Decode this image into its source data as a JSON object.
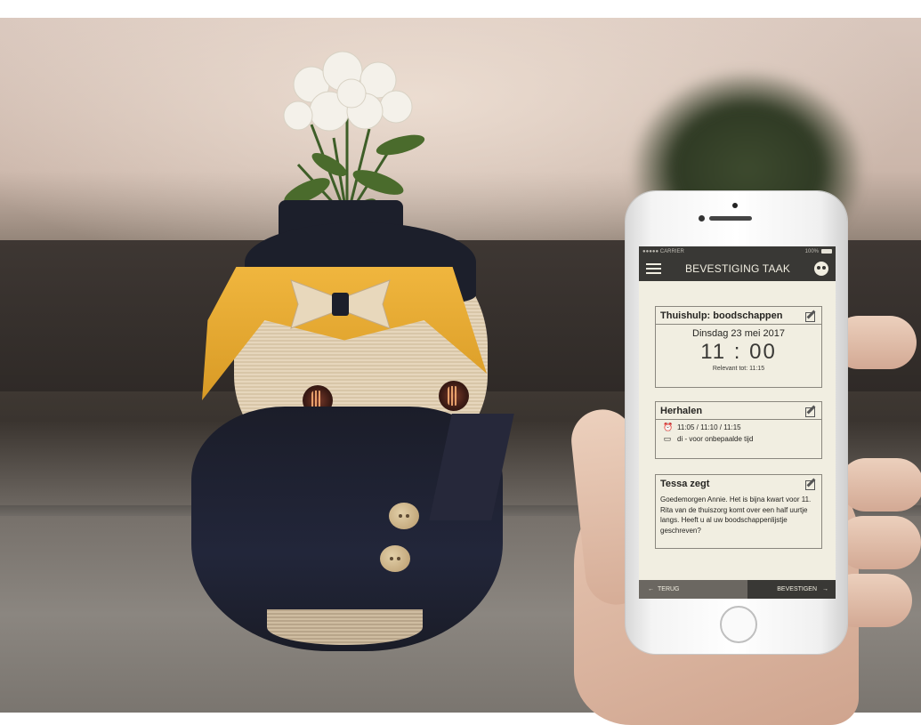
{
  "statusbar": {
    "carrier": "●●●●● CARRIER",
    "battery": "100%"
  },
  "navbar": {
    "title": "BEVESTIGING TAAK",
    "menu_icon": "menu-icon",
    "avatar_icon": "robot-avatar-icon"
  },
  "task_card": {
    "title": "Thuishulp: boodschappen",
    "date": "Dinsdag 23 mei 2017",
    "time": "11 : 00",
    "relevant": "Relevant tot: 11:15"
  },
  "repeat_card": {
    "title": "Herhalen",
    "times": "11:05 / 11:10 / 11:15",
    "schedule": "di - voor onbepaalde tijd",
    "alarm_icon": "alarm-clock-icon",
    "calendar_icon": "calendar-icon"
  },
  "message_card": {
    "title": "Tessa zegt",
    "text": "Goedemorgen Annie. Het is bijna kwart voor 11. Rita van de thuiszorg komt over een half uurtje langs. Heeft u al uw boodschappenlijstje geschreven?"
  },
  "bottombar": {
    "back": "TERUG",
    "confirm": "BEVESTIGEN",
    "back_arrow": "←",
    "confirm_arrow": "→"
  },
  "colors": {
    "accent_dark": "#393835",
    "screen_bg": "#f1eee1",
    "back_button": "#6b6761",
    "scarf_yellow": "#f0b63e"
  }
}
